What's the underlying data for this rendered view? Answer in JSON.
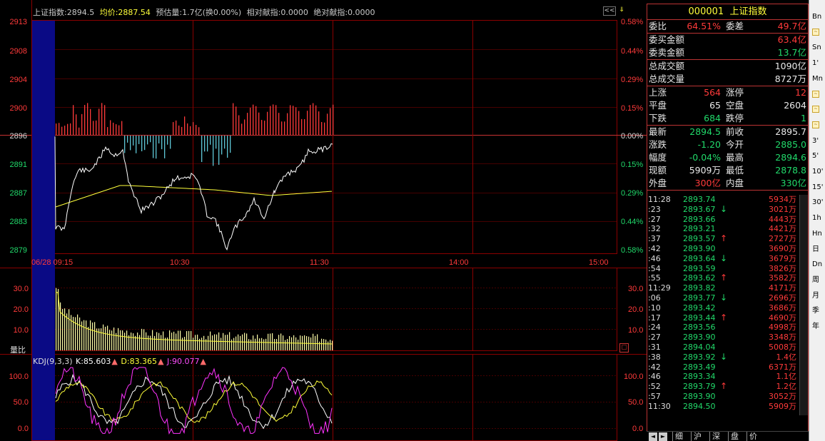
{
  "info_bar": {
    "index_name_value": "上证指数:2894.5",
    "avg_price": "均价:2887.54",
    "est_vol": "预估量:1.7亿(换0.00%)",
    "rel_contrib": "相对献指:0.0000",
    "abs_contrib": "绝对献指:0.0000"
  },
  "buttons": {
    "collapse": "<<",
    "settings": "⇓"
  },
  "price_axis_left": [
    "2913",
    "2908",
    "2904",
    "2900",
    "2896",
    "2891",
    "2887",
    "2883",
    "2879"
  ],
  "price_axis_right": [
    "0.58%",
    "0.44%",
    "0.29%",
    "0.15%",
    "0.00%",
    "0.15%",
    "0.29%",
    "0.44%",
    "0.58%"
  ],
  "time_axis": {
    "t0": "06/28 09:15",
    "t1": "10:30",
    "t2": "11:30",
    "t3": "14:00",
    "t4": "15:00"
  },
  "volume_panel": {
    "label": "量比",
    "ticks_left": [
      "30.0",
      "20.0",
      "10.0"
    ],
    "ticks_right": [
      "30.0",
      "20.0",
      "10.0"
    ],
    "toggle_icon": "▢"
  },
  "kdj_panel": {
    "name": "KDJ(9,3,3)",
    "k": "K:85.603",
    "d": "D:83.365",
    "j": "J:90.077",
    "ticks_left": [
      "100.0",
      "50.0",
      "0.0"
    ],
    "ticks_right": [
      "100.0",
      "50.0",
      "0.0"
    ]
  },
  "colors": {
    "up": "#ff3a3a",
    "down": "#21d96a",
    "avg_line": "#ffff3a",
    "price_line": "#ffffff",
    "grid": "#8b0000",
    "bar_down": "#5fc7d6",
    "j_line": "#ff33ff"
  },
  "panel": {
    "title_code": "000001",
    "title_name": "上证指数",
    "rows1": [
      {
        "l1": "委比",
        "v1": "64.51%",
        "l2": "委差",
        "v2": "49.7亿"
      }
    ],
    "rows2": [
      {
        "l": "委买金额",
        "v": "63.4亿"
      },
      {
        "l": "委卖金额",
        "v": "13.7亿"
      }
    ],
    "rows3": [
      {
        "l": "总成交额",
        "v": "1090亿"
      },
      {
        "l": "总成交量",
        "v": "8727万"
      }
    ],
    "rows4": [
      {
        "l1": "上涨",
        "v1": "564",
        "l2": "涨停",
        "v2": "12"
      },
      {
        "l1": "平盘",
        "v1": "65",
        "l2": "空盘",
        "v2": "2604"
      },
      {
        "l1": "下跌",
        "v1": "684",
        "l2": "跌停",
        "v2": "1"
      }
    ],
    "rows5": [
      {
        "l1": "最新",
        "v1": "2894.5",
        "l2": "前收",
        "v2": "2895.7"
      },
      {
        "l1": "涨跌",
        "v1": "-1.20",
        "l2": "今开",
        "v2": "2885.0"
      },
      {
        "l1": "幅度",
        "v1": "-0.04%",
        "l2": "最高",
        "v2": "2894.6"
      },
      {
        "l1": "现额",
        "v1": "5909万",
        "l2": "最低",
        "v2": "2878.8"
      },
      {
        "l1": "外盘",
        "v1": "300亿",
        "l2": "内盘",
        "v2": "330亿"
      }
    ]
  },
  "ticks": [
    {
      "t": "11:28",
      "p": "2893.74",
      "a": "",
      "v": "5934万"
    },
    {
      "t": ":23",
      "p": "2893.67",
      "a": "↓",
      "v": "3021万"
    },
    {
      "t": ":27",
      "p": "2893.66",
      "a": "",
      "v": "4443万"
    },
    {
      "t": ":32",
      "p": "2893.21",
      "a": "",
      "v": "4421万"
    },
    {
      "t": ":37",
      "p": "2893.57",
      "a": "↑",
      "v": "2727万"
    },
    {
      "t": ":42",
      "p": "2893.90",
      "a": "",
      "v": "3690万"
    },
    {
      "t": ":46",
      "p": "2893.64",
      "a": "↓",
      "v": "3679万"
    },
    {
      "t": ":54",
      "p": "2893.59",
      "a": "",
      "v": "3826万"
    },
    {
      "t": ":55",
      "p": "2893.62",
      "a": "↑",
      "v": "3582万"
    },
    {
      "t": "11:29",
      "p": "2893.82",
      "a": "",
      "v": "4171万"
    },
    {
      "t": ":06",
      "p": "2893.77",
      "a": "↓",
      "v": "2696万"
    },
    {
      "t": ":10",
      "p": "2893.42",
      "a": "",
      "v": "3686万"
    },
    {
      "t": ":17",
      "p": "2893.44",
      "a": "↑",
      "v": "4690万"
    },
    {
      "t": ":24",
      "p": "2893.56",
      "a": "",
      "v": "4998万"
    },
    {
      "t": ":27",
      "p": "2893.90",
      "a": "",
      "v": "3348万"
    },
    {
      "t": ":31",
      "p": "2894.04",
      "a": "",
      "v": "5008万"
    },
    {
      "t": ":38",
      "p": "2893.92",
      "a": "↓",
      "v": "1.4亿"
    },
    {
      "t": ":42",
      "p": "2893.49",
      "a": "",
      "v": "6371万"
    },
    {
      "t": ":46",
      "p": "2893.34",
      "a": "",
      "v": "1.1亿"
    },
    {
      "t": ":52",
      "p": "2893.79",
      "a": "↑",
      "v": "1.2亿"
    },
    {
      "t": ":57",
      "p": "2893.90",
      "a": "",
      "v": "3052万"
    },
    {
      "t": "11:30",
      "p": "2894.50",
      "a": "",
      "v": "5909万"
    }
  ],
  "panel_tabs": [
    "细",
    "沪",
    "深",
    "盘",
    "价"
  ],
  "sidebar": [
    "Bn",
    "",
    "Sn",
    "1'",
    "Mn",
    "",
    "",
    "",
    "3'",
    "5'",
    "10'",
    "15'",
    "30'",
    "1h",
    "Hn",
    "日",
    "Dn",
    "周",
    "月",
    "季",
    "年"
  ]
}
